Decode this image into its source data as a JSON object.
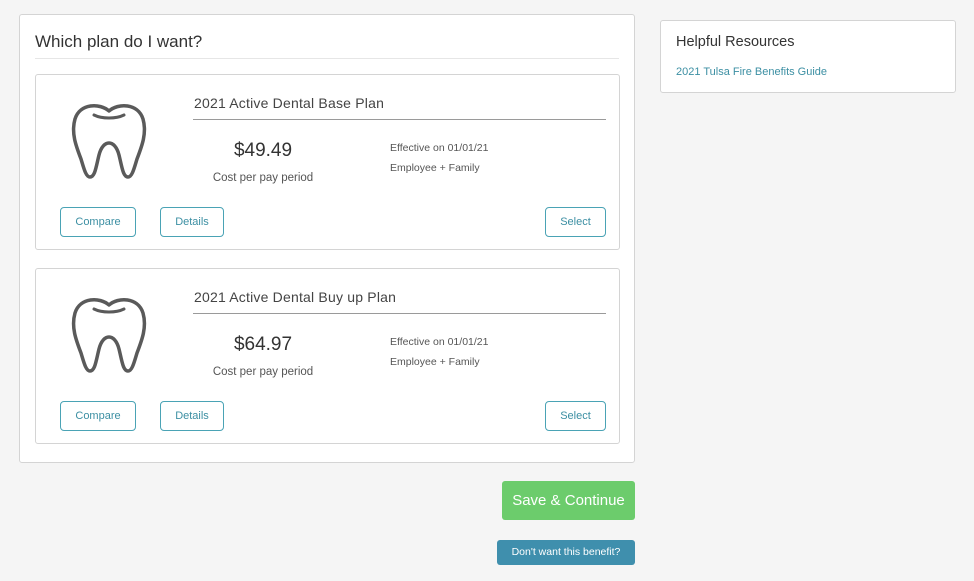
{
  "main": {
    "title": "Which plan do I want?",
    "plans": [
      {
        "name": "2021 Active Dental Base Plan",
        "price": "$49.49",
        "price_caption": "Cost per pay period",
        "effective": "Effective on 01/01/21",
        "coverage": "Employee + Family",
        "compare_label": "Compare",
        "details_label": "Details",
        "select_label": "Select",
        "icon": "tooth-icon"
      },
      {
        "name": "2021 Active Dental Buy up Plan",
        "price": "$64.97",
        "price_caption": "Cost per pay period",
        "effective": "Effective on 01/01/21",
        "coverage": "Employee + Family",
        "compare_label": "Compare",
        "details_label": "Details",
        "select_label": "Select",
        "icon": "tooth-icon"
      }
    ]
  },
  "actions": {
    "save_label": "Save & Continue",
    "decline_label": "Don't want this benefit?"
  },
  "resources": {
    "title": "Helpful Resources",
    "links": [
      {
        "label": "2021 Tulsa Fire Benefits Guide"
      }
    ]
  },
  "colors": {
    "accent": "#3c8fa3",
    "save_green": "#6ccc6c",
    "decline_blue": "#3f8fad"
  }
}
